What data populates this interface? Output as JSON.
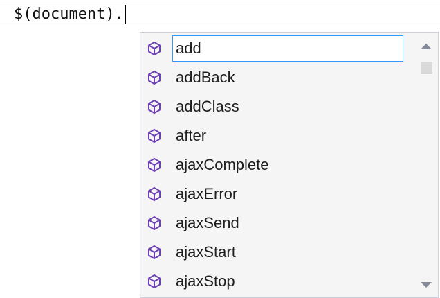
{
  "editor": {
    "code_line": "$(document)."
  },
  "completion": {
    "selected_index": 0,
    "item_icon": "method-cube-icon",
    "icon_color": "#6c3fb5",
    "selection_border_color": "#3399ff",
    "items": [
      {
        "label": "add"
      },
      {
        "label": "addBack"
      },
      {
        "label": "addClass"
      },
      {
        "label": "after"
      },
      {
        "label": "ajaxComplete"
      },
      {
        "label": "ajaxError"
      },
      {
        "label": "ajaxSend"
      },
      {
        "label": "ajaxStart"
      },
      {
        "label": "ajaxStop"
      }
    ]
  },
  "scrollbar": {
    "up_icon": "scroll-up-arrow-icon",
    "down_icon": "scroll-down-arrow-icon",
    "scroll_position_fraction": 0
  }
}
